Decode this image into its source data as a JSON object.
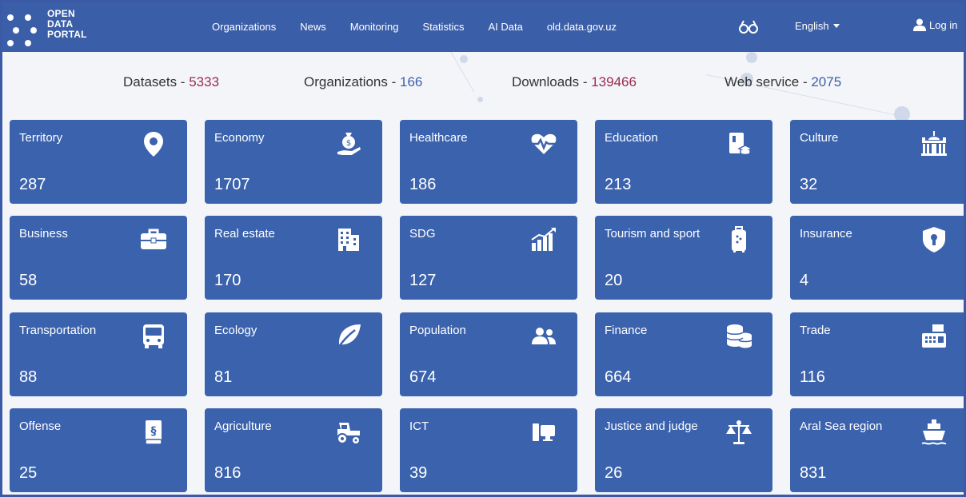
{
  "brand": {
    "line1": "OPEN",
    "line2": "DATA",
    "line3": "PORTAL"
  },
  "nav": {
    "items": [
      "Organizations",
      "News",
      "Monitoring",
      "Statistics",
      "AI Data",
      "old.data.gov.uz"
    ],
    "accessibility_icon": "glasses-icon",
    "language": "English",
    "login": "Log in"
  },
  "stats": {
    "datasets_label": "Datasets - ",
    "datasets_value": "5333",
    "organizations_label": "Organizations - ",
    "organizations_value": "166",
    "downloads_label": "Downloads - ",
    "downloads_value": "139466",
    "webservice_label": "Web service - ",
    "webservice_value": "2075"
  },
  "colors": {
    "primary": "#3b5ea8",
    "tile": "#3b62ad",
    "accent_red": "#9a2b4b",
    "accent_blue": "#3b5ea8"
  },
  "categories": [
    {
      "label": "Territory",
      "count": "287",
      "icon": "map-pin-icon"
    },
    {
      "label": "Economy",
      "count": "1707",
      "icon": "money-bag-hand-icon"
    },
    {
      "label": "Healthcare",
      "count": "186",
      "icon": "heartbeat-icon"
    },
    {
      "label": "Education",
      "count": "213",
      "icon": "book-graduation-icon"
    },
    {
      "label": "Culture",
      "count": "32",
      "icon": "museum-icon"
    },
    {
      "label": "Business",
      "count": "58",
      "icon": "briefcase-icon"
    },
    {
      "label": "Real estate",
      "count": "170",
      "icon": "building-icon"
    },
    {
      "label": "SDG",
      "count": "127",
      "icon": "bar-chart-icon"
    },
    {
      "label": "Tourism and sport",
      "count": "20",
      "icon": "luggage-icon"
    },
    {
      "label": "Insurance",
      "count": "4",
      "icon": "shield-lock-icon"
    },
    {
      "label": "Transportation",
      "count": "88",
      "icon": "bus-icon"
    },
    {
      "label": "Ecology",
      "count": "81",
      "icon": "leaf-icon"
    },
    {
      "label": "Population",
      "count": "674",
      "icon": "users-icon"
    },
    {
      "label": "Finance",
      "count": "664",
      "icon": "coins-icon"
    },
    {
      "label": "Trade",
      "count": "116",
      "icon": "cash-register-icon"
    },
    {
      "label": "Offense",
      "count": "25",
      "icon": "law-book-icon"
    },
    {
      "label": "Agriculture",
      "count": "816",
      "icon": "tractor-icon"
    },
    {
      "label": "ICT",
      "count": "39",
      "icon": "computer-icon"
    },
    {
      "label": "Justice and judge",
      "count": "26",
      "icon": "scales-icon"
    },
    {
      "label": "Aral Sea region",
      "count": "831",
      "icon": "ship-icon"
    }
  ]
}
